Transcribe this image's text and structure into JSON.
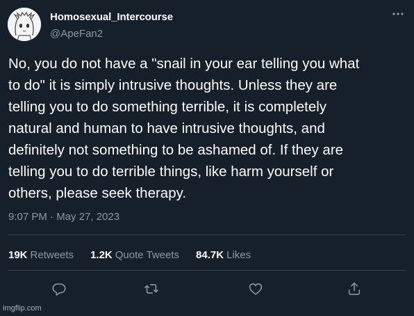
{
  "author": {
    "display_name": "Homosexual_Intercourse",
    "handle": "@ApeFan2"
  },
  "tweet": {
    "text": "No, you do not have a \"snail in your ear telling you what\nto do\" it is simply intrusive thoughts. Unless they are\ntelling you to do something terrible, it is completely\nnatural and human to have intrusive thoughts, and\ndefinitely not something to be ashamed of. If they are\ntelling you to do terrible things, like harm yourself or\nothers, please seek therapy.",
    "timestamp": "9:07 PM · May 27, 2023"
  },
  "stats": {
    "retweets_count": "19K",
    "retweets_label": "Retweets",
    "quotes_count": "1.2K",
    "quotes_label": "Quote Tweets",
    "likes_count": "84.7K",
    "likes_label": "Likes"
  },
  "icons": {
    "more": "more-horizontal-icon",
    "reply": "reply-icon",
    "retweet": "retweet-icon",
    "like": "heart-icon",
    "share": "share-icon"
  },
  "colors": {
    "background": "#15202b",
    "text_primary": "#ffffff",
    "text_secondary": "#8b98a5",
    "divider": "#38444d"
  },
  "watermark": "imgflip.com"
}
